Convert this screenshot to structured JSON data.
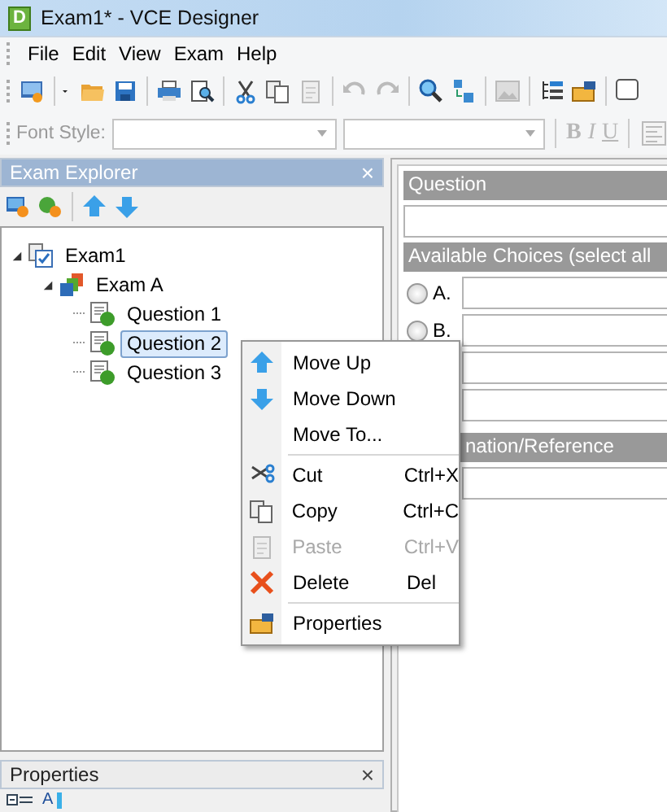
{
  "window": {
    "title": "Exam1* - VCE Designer",
    "app_icon_letter": "D"
  },
  "menu_bar": [
    "File",
    "Edit",
    "View",
    "Exam",
    "Help"
  ],
  "format_toolbar": {
    "label": "Font Style:",
    "format_buttons": [
      {
        "label": "B",
        "disabled": true
      },
      {
        "label": "I",
        "disabled": true
      },
      {
        "label": "U",
        "disabled": true
      }
    ]
  },
  "exam_explorer": {
    "title": "Exam Explorer",
    "close": "×",
    "tree": [
      {
        "label": "Exam1",
        "kind": "exam",
        "expanded": true,
        "selected": false,
        "children": [
          {
            "label": "Exam A",
            "kind": "section",
            "expanded": true,
            "selected": false,
            "children": [
              {
                "label": "Question 1",
                "kind": "question",
                "selected": false
              },
              {
                "label": "Question 2",
                "kind": "question",
                "selected": true
              },
              {
                "label": "Question 3",
                "kind": "question",
                "selected": false
              }
            ]
          }
        ]
      }
    ]
  },
  "properties_panel": {
    "title": "Properties",
    "close": "×",
    "sort_label": "A"
  },
  "question_editor": {
    "question_header": "Question",
    "choices_header": "Available Choices (select all",
    "choices": [
      {
        "label": "A.",
        "selected": false
      },
      {
        "label": "B.",
        "selected": false
      }
    ],
    "explanation_header": "nation/Reference"
  },
  "context_menu": [
    {
      "label": "Move Up",
      "kind": "up",
      "disabled": false,
      "separator_after": false
    },
    {
      "label": "Move Down",
      "kind": "down",
      "disabled": false,
      "separator_after": false
    },
    {
      "label": "Move To...",
      "kind": "plain",
      "disabled": false,
      "separator_after": true
    },
    {
      "label": "Cut",
      "kind": "cut",
      "shortcut": "Ctrl+X",
      "disabled": false,
      "separator_after": false
    },
    {
      "label": "Copy",
      "kind": "copy",
      "shortcut": "Ctrl+C",
      "disabled": false,
      "separator_after": false
    },
    {
      "label": "Paste",
      "kind": "paste",
      "shortcut": "Ctrl+V",
      "disabled": true,
      "separator_after": false
    },
    {
      "label": "Delete",
      "kind": "delete",
      "shortcut": "Del",
      "disabled": false,
      "separator_after": true
    },
    {
      "label": "Properties",
      "kind": "props",
      "disabled": false,
      "separator_after": false
    }
  ]
}
